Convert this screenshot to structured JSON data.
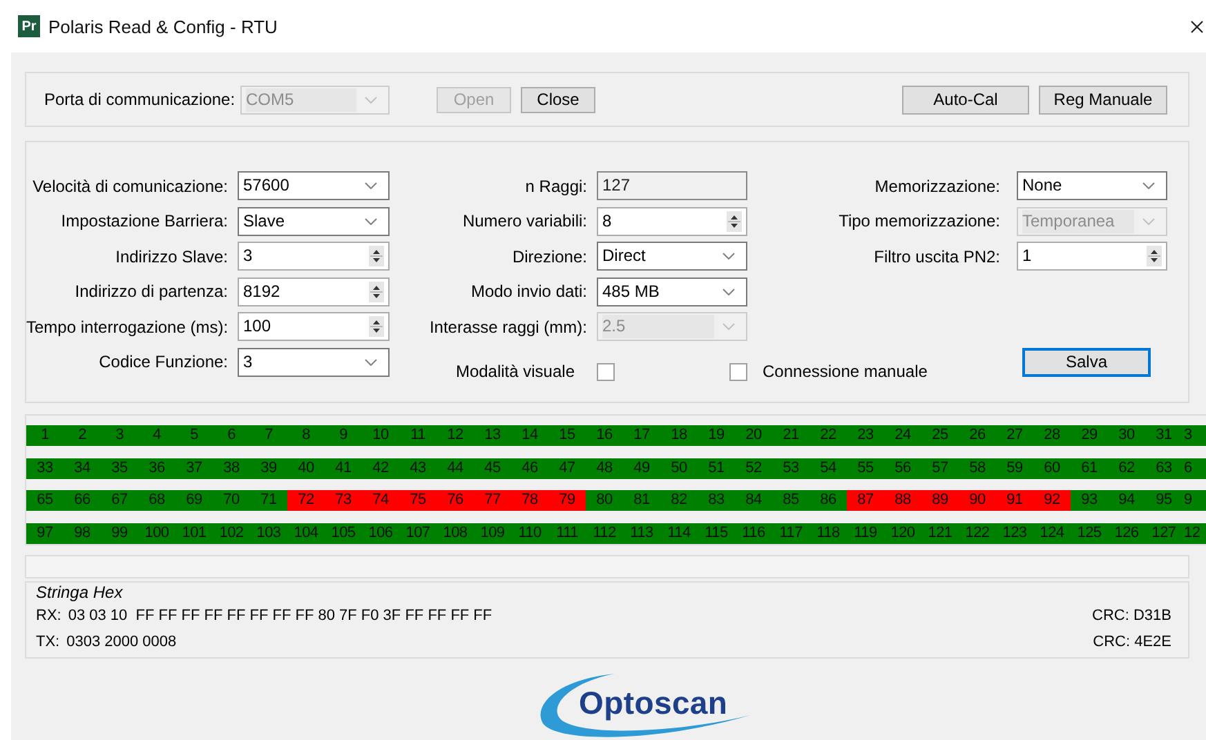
{
  "window": {
    "title": "Polaris Read & Config - RTU",
    "app_icon": "Pr"
  },
  "connection": {
    "label": "Porta di communicazione:",
    "port": {
      "value": "COM5",
      "kind": "combo",
      "disabled": true
    },
    "buttons": [
      {
        "label": "Open",
        "disabled": true
      },
      {
        "label": "Close",
        "disabled": false
      }
    ],
    "actions": [
      {
        "label": "Auto-Cal",
        "disabled": false
      },
      {
        "label": "Reg Manuale",
        "disabled": false
      }
    ]
  },
  "settings": {
    "columns": [
      [
        {
          "label": "Velocità di comunicazione:",
          "value": "57600",
          "kind": "combo",
          "disabled": false
        },
        {
          "label": "Impostazione Barriera:",
          "value": "Slave",
          "kind": "combo",
          "disabled": false
        },
        {
          "label": "Indirizzo Slave:",
          "value": "3",
          "kind": "spin",
          "disabled": false
        },
        {
          "label": "Indirizzo di partenza:",
          "value": "8192",
          "kind": "spin",
          "disabled": false
        },
        {
          "label": "Tempo interrogazione (ms):",
          "value": "100",
          "kind": "spin",
          "disabled": false
        },
        {
          "label": "Codice Funzione:",
          "value": "3",
          "kind": "combo",
          "disabled": false
        }
      ],
      [
        {
          "label": "n Raggi:",
          "value": "127",
          "kind": "text",
          "disabled": false
        },
        {
          "label": "Numero variabili:",
          "value": "8",
          "kind": "spin",
          "disabled": false
        },
        {
          "label": "Direzione:",
          "value": "Direct",
          "kind": "combo",
          "disabled": false
        },
        {
          "label": "Modo invio dati:",
          "value": "485 MB",
          "kind": "combo",
          "disabled": false
        },
        {
          "label": "Interasse raggi (mm):",
          "value": "2.5",
          "kind": "combo",
          "disabled": true
        }
      ],
      [
        {
          "label": "Memorizzazione:",
          "value": "None",
          "kind": "combo",
          "disabled": false
        },
        {
          "label": "Tipo memorizzazione:",
          "value": "Temporanea",
          "kind": "combo",
          "disabled": true
        },
        {
          "label": "Filtro uscita PN2:",
          "value": "1",
          "kind": "spin",
          "disabled": false
        }
      ]
    ],
    "checkboxes": [
      {
        "label": "Modalità visuale",
        "checked": false
      },
      {
        "label": "Connessione manuale",
        "checked": false
      }
    ],
    "save_button": {
      "label": "Salva",
      "focused": true
    }
  },
  "beams": {
    "rows": [
      [
        {
          "label": "1",
          "blocked": false
        },
        {
          "label": "2",
          "blocked": false
        },
        {
          "label": "3",
          "blocked": false
        },
        {
          "label": "4",
          "blocked": false
        },
        {
          "label": "5",
          "blocked": false
        },
        {
          "label": "6",
          "blocked": false
        },
        {
          "label": "7",
          "blocked": false
        },
        {
          "label": "8",
          "blocked": false
        },
        {
          "label": "9",
          "blocked": false
        },
        {
          "label": "10",
          "blocked": false
        },
        {
          "label": "11",
          "blocked": false
        },
        {
          "label": "12",
          "blocked": false
        },
        {
          "label": "13",
          "blocked": false
        },
        {
          "label": "14",
          "blocked": false
        },
        {
          "label": "15",
          "blocked": false
        },
        {
          "label": "16",
          "blocked": false
        },
        {
          "label": "17",
          "blocked": false
        },
        {
          "label": "18",
          "blocked": false
        },
        {
          "label": "19",
          "blocked": false
        },
        {
          "label": "20",
          "blocked": false
        },
        {
          "label": "21",
          "blocked": false
        },
        {
          "label": "22",
          "blocked": false
        },
        {
          "label": "23",
          "blocked": false
        },
        {
          "label": "24",
          "blocked": false
        },
        {
          "label": "25",
          "blocked": false
        },
        {
          "label": "26",
          "blocked": false
        },
        {
          "label": "27",
          "blocked": false
        },
        {
          "label": "28",
          "blocked": false
        },
        {
          "label": "29",
          "blocked": false
        },
        {
          "label": "30",
          "blocked": false
        },
        {
          "label": "31",
          "blocked": false
        },
        {
          "label": "3",
          "blocked": false
        }
      ],
      [
        {
          "label": "33",
          "blocked": false
        },
        {
          "label": "34",
          "blocked": false
        },
        {
          "label": "35",
          "blocked": false
        },
        {
          "label": "36",
          "blocked": false
        },
        {
          "label": "37",
          "blocked": false
        },
        {
          "label": "38",
          "blocked": false
        },
        {
          "label": "39",
          "blocked": false
        },
        {
          "label": "40",
          "blocked": false
        },
        {
          "label": "41",
          "blocked": false
        },
        {
          "label": "42",
          "blocked": false
        },
        {
          "label": "43",
          "blocked": false
        },
        {
          "label": "44",
          "blocked": false
        },
        {
          "label": "45",
          "blocked": false
        },
        {
          "label": "46",
          "blocked": false
        },
        {
          "label": "47",
          "blocked": false
        },
        {
          "label": "48",
          "blocked": false
        },
        {
          "label": "49",
          "blocked": false
        },
        {
          "label": "50",
          "blocked": false
        },
        {
          "label": "51",
          "blocked": false
        },
        {
          "label": "52",
          "blocked": false
        },
        {
          "label": "53",
          "blocked": false
        },
        {
          "label": "54",
          "blocked": false
        },
        {
          "label": "55",
          "blocked": false
        },
        {
          "label": "56",
          "blocked": false
        },
        {
          "label": "57",
          "blocked": false
        },
        {
          "label": "58",
          "blocked": false
        },
        {
          "label": "59",
          "blocked": false
        },
        {
          "label": "60",
          "blocked": false
        },
        {
          "label": "61",
          "blocked": false
        },
        {
          "label": "62",
          "blocked": false
        },
        {
          "label": "63",
          "blocked": false
        },
        {
          "label": "6",
          "blocked": false
        }
      ],
      [
        {
          "label": "65",
          "blocked": false
        },
        {
          "label": "66",
          "blocked": false
        },
        {
          "label": "67",
          "blocked": false
        },
        {
          "label": "68",
          "blocked": false
        },
        {
          "label": "69",
          "blocked": false
        },
        {
          "label": "70",
          "blocked": false
        },
        {
          "label": "71",
          "blocked": false
        },
        {
          "label": "72",
          "blocked": true
        },
        {
          "label": "73",
          "blocked": true
        },
        {
          "label": "74",
          "blocked": true
        },
        {
          "label": "75",
          "blocked": true
        },
        {
          "label": "76",
          "blocked": true
        },
        {
          "label": "77",
          "blocked": true
        },
        {
          "label": "78",
          "blocked": true
        },
        {
          "label": "79",
          "blocked": true
        },
        {
          "label": "80",
          "blocked": false
        },
        {
          "label": "81",
          "blocked": false
        },
        {
          "label": "82",
          "blocked": false
        },
        {
          "label": "83",
          "blocked": false
        },
        {
          "label": "84",
          "blocked": false
        },
        {
          "label": "85",
          "blocked": false
        },
        {
          "label": "86",
          "blocked": false
        },
        {
          "label": "87",
          "blocked": true
        },
        {
          "label": "88",
          "blocked": true
        },
        {
          "label": "89",
          "blocked": true
        },
        {
          "label": "90",
          "blocked": true
        },
        {
          "label": "91",
          "blocked": true
        },
        {
          "label": "92",
          "blocked": true
        },
        {
          "label": "93",
          "blocked": false
        },
        {
          "label": "94",
          "blocked": false
        },
        {
          "label": "95",
          "blocked": false
        },
        {
          "label": "9",
          "blocked": false
        }
      ],
      [
        {
          "label": "97",
          "blocked": false
        },
        {
          "label": "98",
          "blocked": false
        },
        {
          "label": "99",
          "blocked": false
        },
        {
          "label": "100",
          "blocked": false
        },
        {
          "label": "101",
          "blocked": false
        },
        {
          "label": "102",
          "blocked": false
        },
        {
          "label": "103",
          "blocked": false
        },
        {
          "label": "104",
          "blocked": false
        },
        {
          "label": "105",
          "blocked": false
        },
        {
          "label": "106",
          "blocked": false
        },
        {
          "label": "107",
          "blocked": false
        },
        {
          "label": "108",
          "blocked": false
        },
        {
          "label": "109",
          "blocked": false
        },
        {
          "label": "110",
          "blocked": false
        },
        {
          "label": "111",
          "blocked": false
        },
        {
          "label": "112",
          "blocked": false
        },
        {
          "label": "113",
          "blocked": false
        },
        {
          "label": "114",
          "blocked": false
        },
        {
          "label": "115",
          "blocked": false
        },
        {
          "label": "116",
          "blocked": false
        },
        {
          "label": "117",
          "blocked": false
        },
        {
          "label": "118",
          "blocked": false
        },
        {
          "label": "119",
          "blocked": false
        },
        {
          "label": "120",
          "blocked": false
        },
        {
          "label": "121",
          "blocked": false
        },
        {
          "label": "122",
          "blocked": false
        },
        {
          "label": "123",
          "blocked": false
        },
        {
          "label": "124",
          "blocked": false
        },
        {
          "label": "125",
          "blocked": false
        },
        {
          "label": "126",
          "blocked": false
        },
        {
          "label": "127",
          "blocked": false
        },
        {
          "label": "12",
          "blocked": false
        }
      ]
    ]
  },
  "hex": {
    "title": "Stringa Hex",
    "lines": [
      {
        "label": "RX:",
        "data": "03 03 10  FF FF FF FF FF FF FF FF 80 7F F0 3F FF FF FF FF",
        "crc": "CRC: D31B"
      },
      {
        "label": "TX:",
        "data": "0303 2000 0008",
        "crc": "CRC: 4E2E"
      }
    ]
  },
  "logo": {
    "text": "Optoscan"
  }
}
